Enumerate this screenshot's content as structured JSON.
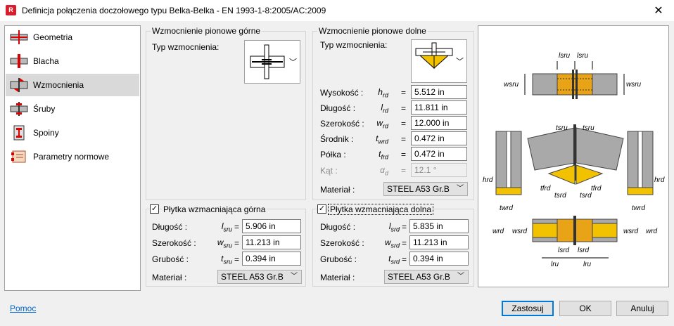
{
  "window": {
    "title": "Definicja połączenia doczołowego typu Belka-Belka - EN 1993-1-8:2005/AC:2009",
    "close_glyph": "✕",
    "app_icon_letter": "R"
  },
  "nav": {
    "items": [
      {
        "label": "Geometria",
        "icon": "beam-geometry-icon"
      },
      {
        "label": "Blacha",
        "icon": "plate-icon"
      },
      {
        "label": "Wzmocnienia",
        "icon": "stiffener-icon",
        "selected": true
      },
      {
        "label": "Śruby",
        "icon": "bolt-icon"
      },
      {
        "label": "Spoiny",
        "icon": "weld-icon"
      },
      {
        "label": "Parametry normowe",
        "icon": "code-parameters-icon"
      }
    ]
  },
  "upper_vertical": {
    "title": "Wzmocnienie pionowe górne",
    "type_label": "Typ wzmocnienia:"
  },
  "lower_vertical": {
    "title": "Wzmocnienie pionowe dolne",
    "type_label": "Typ wzmocnienia:",
    "fields": [
      {
        "label": "Wysokość :",
        "sym": "h",
        "sub": "rd",
        "value": "5.512 in"
      },
      {
        "label": "Długość :",
        "sym": "l",
        "sub": "rd",
        "value": "11.811 in"
      },
      {
        "label": "Szerokość :",
        "sym": "w",
        "sub": "rd",
        "value": "12.000 in"
      },
      {
        "label": "Środnik :",
        "sym": "t",
        "sub": "wrd",
        "value": "0.472 in"
      },
      {
        "label": "Półka :",
        "sym": "t",
        "sub": "frd",
        "value": "0.472 in"
      },
      {
        "label": "Kąt :",
        "sym": "α",
        "sub": "d",
        "value": "12.1 °",
        "disabled": true
      }
    ],
    "material_label": "Materiał :",
    "material_value": "STEEL A53 Gr.B"
  },
  "upper_plate": {
    "title": "Płytka wzmacniająca górna",
    "checked": true,
    "fields": [
      {
        "label": "Długość :",
        "sym": "l",
        "sub": "sru",
        "value": "5.906 in"
      },
      {
        "label": "Szerokość :",
        "sym": "w",
        "sub": "sru",
        "value": "11.213 in"
      },
      {
        "label": "Grubość :",
        "sym": "t",
        "sub": "sru",
        "value": "0.394 in"
      }
    ],
    "material_label": "Materiał :",
    "material_value": "STEEL A53 Gr.B"
  },
  "lower_plate": {
    "title": "Płytka wzmacniająca dolna",
    "checked": true,
    "fields": [
      {
        "label": "Długość :",
        "sym": "l",
        "sub": "srd",
        "value": "5.835 in"
      },
      {
        "label": "Szerokość :",
        "sym": "w",
        "sub": "srd",
        "value": "11.213 in"
      },
      {
        "label": "Grubość :",
        "sym": "t",
        "sub": "srd",
        "value": "0.394 in"
      }
    ],
    "material_label": "Materiał :",
    "material_value": "STEEL A53 Gr.B"
  },
  "preview": {
    "labels": {
      "lsru": "lsru",
      "wsru": "wsru",
      "tsru": "tsru",
      "hrd": "hrd",
      "twrd": "twrd",
      "tfrd": "tfrd",
      "tsrd": "tsrd",
      "wrd": "wrd",
      "wsrd": "wsrd",
      "lsrd": "lsrd",
      "lru": "lru"
    }
  },
  "footer": {
    "help_link": "Pomoc",
    "apply": "Zastosuj",
    "ok": "OK",
    "cancel": "Anuluj"
  },
  "colors": {
    "accent": "#0078d7",
    "steel": "#a9a9a9",
    "weld": "#f2c200",
    "highlight": "#e8a317"
  }
}
